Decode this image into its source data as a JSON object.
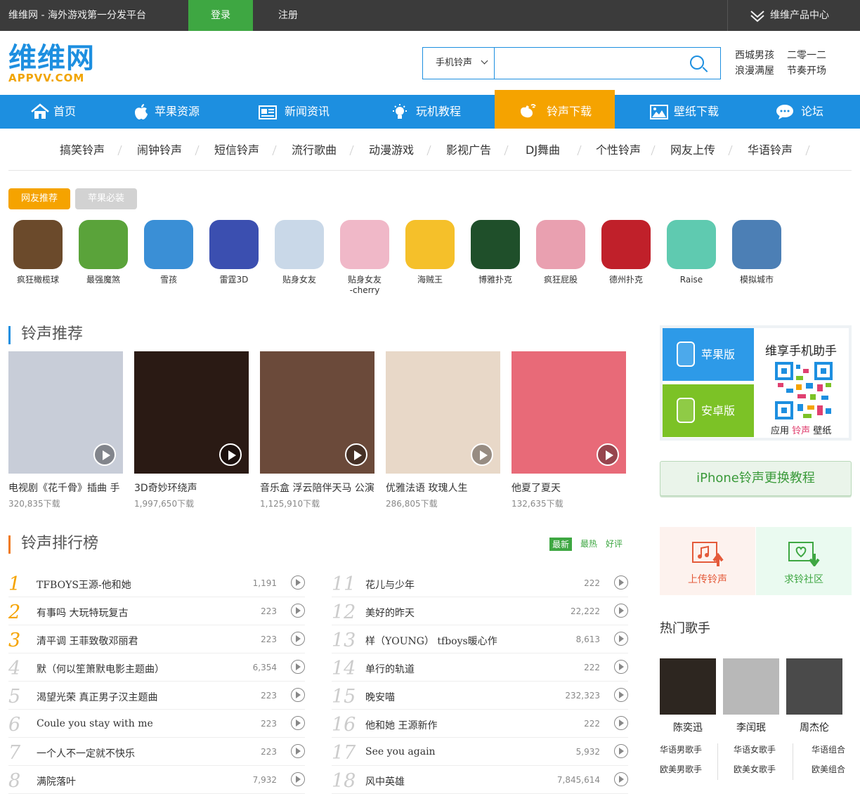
{
  "topbar": {
    "site": "维维网 - 海外游戏第一分发平台",
    "login": "登录",
    "register": "注册",
    "products": "维维产品中心"
  },
  "logo": {
    "main": "维维网",
    "domain": "APPVV.COM"
  },
  "search": {
    "category": "手机铃声",
    "placeholder": ""
  },
  "hot_keywords": [
    "西城男孩",
    "二零一二",
    "浪漫满屋",
    "节奏开场"
  ],
  "nav": [
    {
      "label": "首页",
      "icon": "home-icon"
    },
    {
      "label": "苹果资源",
      "icon": "apple-icon"
    },
    {
      "label": "新闻资讯",
      "icon": "news-icon"
    },
    {
      "label": "玩机教程",
      "icon": "bulb-icon"
    },
    {
      "label": "铃声下载",
      "icon": "music-icon",
      "active": true
    },
    {
      "label": "壁纸下载",
      "icon": "picture-icon"
    },
    {
      "label": "论坛",
      "icon": "chat-icon"
    }
  ],
  "subnav": [
    "搞笑铃声",
    "闹钟铃声",
    "短信铃声",
    "流行歌曲",
    "动漫游戏",
    "影视广告",
    "DJ舞曲",
    "个性铃声",
    "网友上传",
    "华语铃声"
  ],
  "app_tabs": [
    "网友推荐",
    "苹果必装"
  ],
  "apps": [
    {
      "name": "疯狂橄榄球",
      "color": "#6b4a2b"
    },
    {
      "name": "最强魔煞",
      "color": "#5aa33a"
    },
    {
      "name": "雪孩",
      "color": "#3a8fd6"
    },
    {
      "name": "雷霆3D",
      "color": "#3b4fb0"
    },
    {
      "name": "贴身女友",
      "color": "#c9d8e8"
    },
    {
      "name": "贴身女友\n-cherry",
      "color": "#f0b8c8"
    },
    {
      "name": "海贼王",
      "color": "#f5c02a"
    },
    {
      "name": "博雅扑克",
      "color": "#1f4f2a"
    },
    {
      "name": "疯狂屁股",
      "color": "#e9a0b0"
    },
    {
      "name": "德州扑克",
      "color": "#c0202a"
    },
    {
      "name": "Raise",
      "color": "#5fcab0"
    },
    {
      "name": "模拟城市",
      "color": "#4c7fb5"
    }
  ],
  "recommend": {
    "title": "铃声推荐",
    "items": [
      {
        "title": "电视剧《花千骨》插曲 手",
        "downloads": "320,835下载",
        "color": "#c8cdd8"
      },
      {
        "title": "3D奇妙环绕声",
        "downloads": "1,997,650下载",
        "color": "#2a1a14"
      },
      {
        "title": "音乐盒 浮云陪伴天马 公演",
        "downloads": "1,125,910下载",
        "color": "#6b4a3a"
      },
      {
        "title": "优雅法语 玫瑰人生",
        "downloads": "286,805下载",
        "color": "#e8d8c8"
      },
      {
        "title": "他夏了夏天",
        "downloads": "132,635下载",
        "color": "#e86a78"
      }
    ]
  },
  "ranking": {
    "title": "铃声排行榜",
    "tabs": [
      "最新",
      "最热",
      "好评"
    ],
    "left": [
      {
        "no": "1",
        "name": "TFBOYS王源-他和她",
        "count": "1,191"
      },
      {
        "no": "2",
        "name": "有事吗 大玩特玩复古",
        "count": "223"
      },
      {
        "no": "3",
        "name": "清平调 王菲致敬邓丽君",
        "count": "223"
      },
      {
        "no": "4",
        "name": "默（何以笙箫默电影主题曲）",
        "count": "6,354"
      },
      {
        "no": "5",
        "name": "渴望光荣 真正男子汉主题曲",
        "count": "223"
      },
      {
        "no": "6",
        "name": "Coule you stay with me",
        "count": "223"
      },
      {
        "no": "7",
        "name": "一个人不一定就不快乐",
        "count": "223"
      },
      {
        "no": "8",
        "name": "满院落叶",
        "count": "7,932"
      }
    ],
    "right": [
      {
        "no": "11",
        "name": "花儿与少年",
        "count": "222"
      },
      {
        "no": "12",
        "name": "美好的昨天",
        "count": "22,222"
      },
      {
        "no": "13",
        "name": "样（YOUNG） tfboys暖心作",
        "count": "8,613"
      },
      {
        "no": "14",
        "name": "单行的轨道",
        "count": "222"
      },
      {
        "no": "15",
        "name": "晚安喵",
        "count": "232,323"
      },
      {
        "no": "16",
        "name": "他和她 王源新作",
        "count": "222"
      },
      {
        "no": "17",
        "name": "See you again",
        "count": "5,932"
      },
      {
        "no": "18",
        "name": "风中英雄",
        "count": "7,845,614"
      }
    ]
  },
  "sidebar": {
    "apple": "苹果版",
    "android": "安卓版",
    "assistant": "维享手机助手",
    "qr_caption": {
      "a": "应用",
      "b": "铃声",
      "c": "壁纸"
    },
    "tutorial": "iPhone铃声更换教程",
    "upload": "上传铃声",
    "request": "求铃社区",
    "hot_title": "热门歌手",
    "singers": [
      {
        "name": "陈奕迅",
        "color": "#2d2620"
      },
      {
        "name": "李闰珉",
        "color": "#b8b8b8"
      },
      {
        "name": "周杰伦",
        "color": "#4a4a4a"
      }
    ],
    "categories": [
      [
        "华语男歌手",
        "华语女歌手",
        "华语组合"
      ],
      [
        "欧美男歌手",
        "欧美女歌手",
        "欧美组合"
      ]
    ]
  },
  "colors": {
    "brand_blue": "#1d8fe0",
    "accent_orange": "#f5a300",
    "green": "#3ea742"
  }
}
